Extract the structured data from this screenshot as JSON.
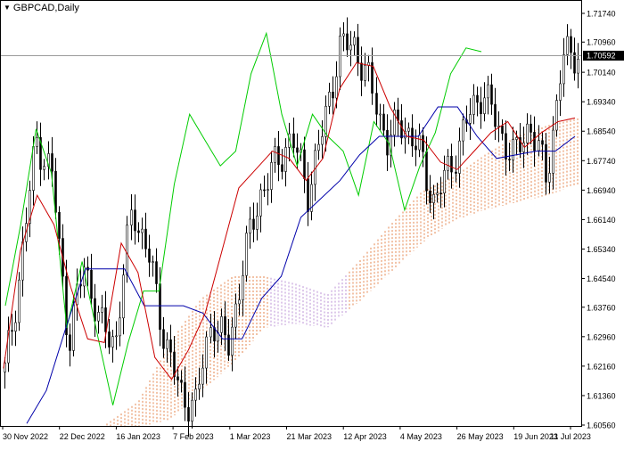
{
  "window": {
    "symbol_label": "GBPCAD,Daily",
    "menu_icon": "triangle-down-icon"
  },
  "price_tag": {
    "value": "1.70592",
    "bg_color": "#000000",
    "text_color": "#ffffff"
  },
  "colors": {
    "background": "#ffffff",
    "candle": "#000000",
    "tenkan": "#cc0000",
    "kijun": "#0000aa",
    "chikou": "#00cc00",
    "cloud_up": "#e07030",
    "cloud_down": "#b080d0",
    "current_price_line": "#999999"
  },
  "chart_data": {
    "type": "candlestick",
    "instrument": "GBPCAD",
    "timeframe": "Daily",
    "indicator": "Ichimoku Kinko Hyo",
    "ylim": [
      1.6056,
      1.7174
    ],
    "y_ticks": [
      "1.71740",
      "1.70960",
      "1.70140",
      "1.69340",
      "1.68540",
      "1.67740",
      "1.66940",
      "1.66140",
      "1.65340",
      "1.64540",
      "1.63760",
      "1.62960",
      "1.62160",
      "1.61360",
      "1.60560"
    ],
    "x_ticks": [
      "30 Nov 2022",
      "22 Dec 2022",
      "16 Jan 2023",
      "7 Feb 2023",
      "1 Mar 2023",
      "21 Mar 2023",
      "12 Apr 2023",
      "4 May 2023",
      "26 May 2023",
      "19 Jun 2023",
      "11 Jul 2023"
    ],
    "last_price": 1.70592,
    "close_path": [
      1.62,
      1.648,
      1.684,
      1.672,
      1.628,
      1.65,
      1.632,
      1.629,
      1.665,
      1.652,
      1.63,
      1.614,
      1.611,
      1.635,
      1.626,
      1.65,
      1.668,
      1.676,
      1.684,
      1.669,
      1.686,
      1.708,
      1.709,
      1.697,
      1.683,
      1.688,
      1.68,
      1.666,
      1.676,
      1.688,
      1.697,
      1.686,
      1.678,
      1.688,
      1.672,
      1.705,
      1.707
    ],
    "tenkan_path": [
      1.621,
      1.653,
      1.668,
      1.66,
      1.643,
      1.629,
      1.628,
      1.655,
      1.647,
      1.624,
      1.618,
      1.626,
      1.636,
      1.653,
      1.67,
      1.675,
      1.68,
      1.678,
      1.672,
      1.678,
      1.697,
      1.704,
      1.703,
      1.692,
      1.684,
      1.683,
      1.677,
      1.675,
      1.68,
      1.685,
      1.688,
      1.681,
      1.685,
      1.688,
      1.689
    ],
    "kijun_path": [
      1.606,
      1.615,
      1.632,
      1.648,
      1.648,
      1.648,
      1.638,
      1.638,
      1.638,
      1.636,
      1.629,
      1.629,
      1.64,
      1.646,
      1.662,
      1.667,
      1.672,
      1.679,
      1.684,
      1.684,
      1.684,
      1.692,
      1.692,
      1.684,
      1.678,
      1.679,
      1.68,
      1.68,
      1.684
    ],
    "chikou_path": [
      1.638,
      1.66,
      1.686,
      1.674,
      1.632,
      1.65,
      1.63,
      1.611,
      1.628,
      1.642,
      1.642,
      1.671,
      1.69,
      1.683,
      1.676,
      1.68,
      1.701,
      1.712,
      1.69,
      1.676,
      1.69,
      1.684,
      1.68,
      1.668,
      1.688,
      1.682,
      1.664,
      1.676,
      1.685,
      1.701,
      1.708,
      1.707
    ],
    "cloud_top": [
      1.606,
      1.612,
      1.628,
      1.64,
      1.646,
      1.646,
      1.644,
      1.641,
      1.65,
      1.66,
      1.669,
      1.673,
      1.679,
      1.684,
      1.687,
      1.689
    ],
    "cloud_bottom": [
      1.606,
      1.606,
      1.608,
      1.616,
      1.623,
      1.633,
      1.634,
      1.633,
      1.64,
      1.648,
      1.656,
      1.662,
      1.665,
      1.667,
      1.669,
      1.672
    ]
  }
}
